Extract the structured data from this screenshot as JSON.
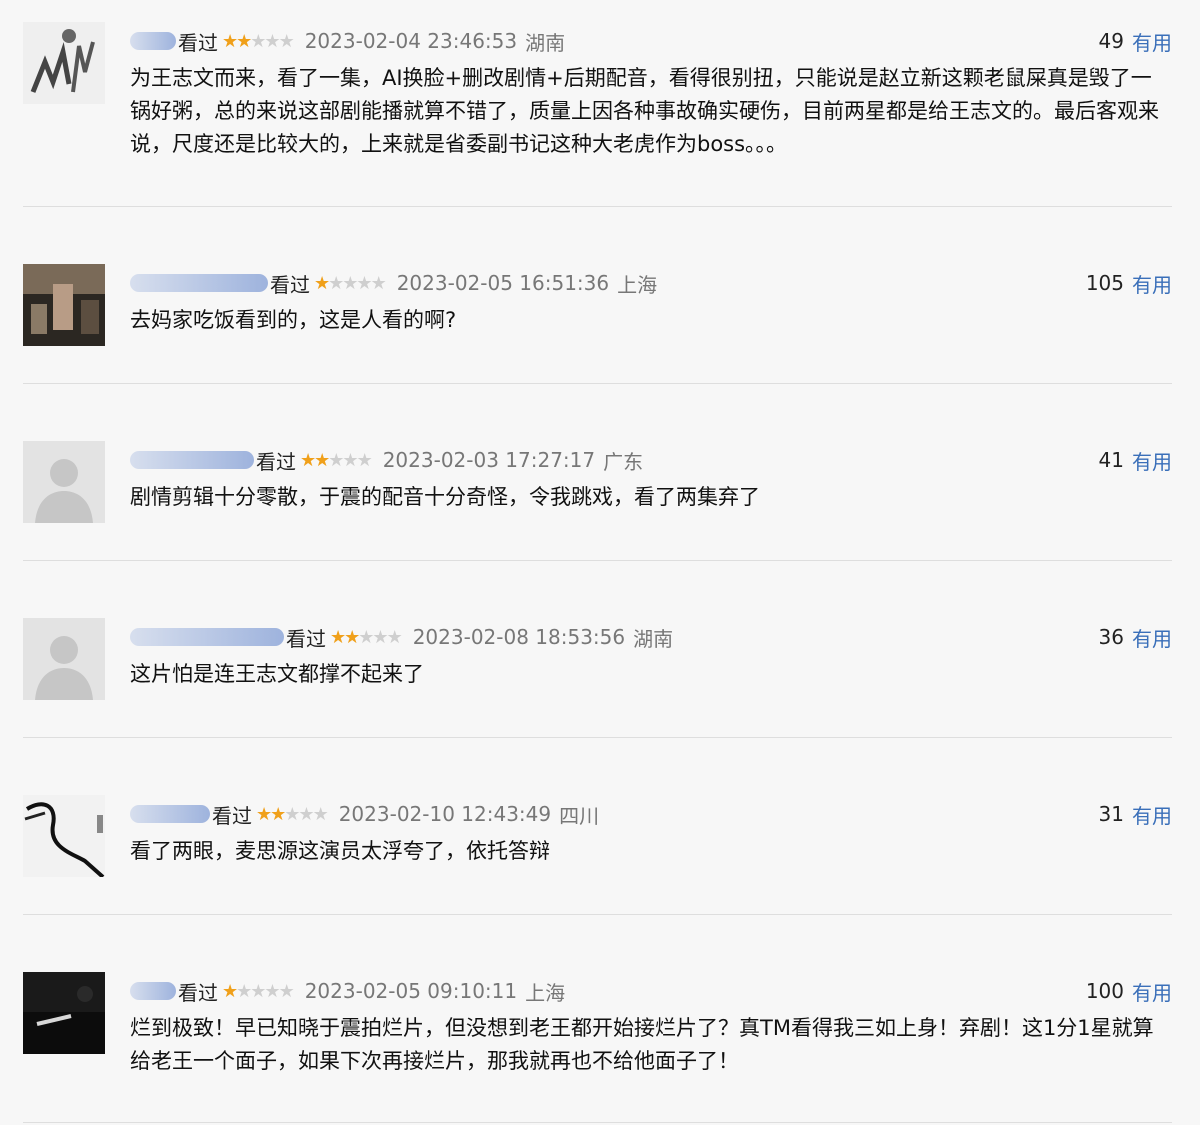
{
  "comments": [
    {
      "status": "看过",
      "rating": 2,
      "time": "2023-02-04 23:46:53",
      "location": "湖南",
      "votes": "49",
      "useful_label": "有用",
      "text": "为王志文而来，看了一集，AI换脸+删改剧情+后期配音，看得很别扭，只能说是赵立新这颗老鼠屎真是毁了一锅好粥，总的来说这部剧能播就算不错了，质量上因各种事故确实硬伤，目前两星都是给王志文的。最后客观来说，尺度还是比较大的，上来就是省委副书记这种大老虎作为boss。。。"
    },
    {
      "status": "看过",
      "rating": 1,
      "time": "2023-02-05 16:51:36",
      "location": "上海",
      "votes": "105",
      "useful_label": "有用",
      "text": "去妈家吃饭看到的，这是人看的啊?"
    },
    {
      "status": "看过",
      "rating": 2,
      "time": "2023-02-03 17:27:17",
      "location": "广东",
      "votes": "41",
      "useful_label": "有用",
      "text": "剧情剪辑十分零散，于震的配音十分奇怪，令我跳戏，看了两集弃了"
    },
    {
      "status": "看过",
      "rating": 2,
      "time": "2023-02-08 18:53:56",
      "location": "湖南",
      "votes": "36",
      "useful_label": "有用",
      "text": "这片怕是连王志文都撑不起来了"
    },
    {
      "status": "看过",
      "rating": 2,
      "time": "2023-02-10 12:43:49",
      "location": "四川",
      "votes": "31",
      "useful_label": "有用",
      "text": "看了两眼，麦思源这演员太浮夸了，依托答辩"
    },
    {
      "status": "看过",
      "rating": 1,
      "time": "2023-02-05 09:10:11",
      "location": "上海",
      "votes": "100",
      "useful_label": "有用",
      "text": "烂到极致！早已知晓于震拍烂片，但没想到老王都开始接烂片了？真TM看得我三如上身！弃剧！这1分1星就算给老王一个面子，如果下次再接烂片，那我就再也不给他面子了！"
    }
  ]
}
